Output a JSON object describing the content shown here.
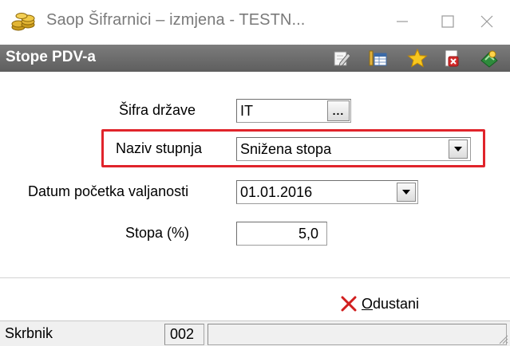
{
  "window": {
    "title": "Saop Šifrarnici – izmjena  - TESTN...",
    "app_icon": "coins-stack-icon",
    "controls": [
      "minimize-icon",
      "maximize-icon",
      "close-icon"
    ]
  },
  "header": {
    "title": "Stope PDV-a",
    "toolbar_icons": [
      "edit-pencil-icon",
      "table-view-icon",
      "favorite-star-icon",
      "delete-document-icon",
      "exit-icon"
    ]
  },
  "form": {
    "sifra_drzave": {
      "label": "Šifra države",
      "value": "IT",
      "button": "..."
    },
    "naziv_stupnja": {
      "label": "Naziv stupnja",
      "value": "Snižena stopa"
    },
    "datum_pocetka": {
      "label": "Datum početka valjanosti",
      "value": "01.01.2016"
    },
    "stopa": {
      "label": "Stopa (%)",
      "value": "5,0"
    }
  },
  "actions": {
    "cancel_label_first": "O",
    "cancel_label_rest": "dustani"
  },
  "statusbar": {
    "user_label": "Skrbnik",
    "code": "002",
    "message": ""
  },
  "colors": {
    "highlight": "#e0242b",
    "header_bg": "#6c6c6c",
    "cancel_x": "#d11f1f"
  }
}
